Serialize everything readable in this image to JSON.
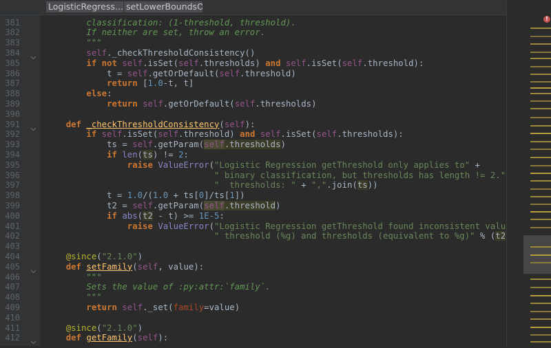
{
  "breadcrumbs": [
    "LogisticRegress…",
    "setLowerBoundsO…"
  ],
  "error_marker": "!",
  "colors": {
    "keyword": "#cc7832",
    "self": "#94558d",
    "string": "#6a8759",
    "docstring": "#629755",
    "number": "#6897bb",
    "function": "#ffc66d",
    "builtin": "#8888c6",
    "decorator": "#bbb529",
    "background": "#2b2b2b"
  },
  "first_line": "classification: (1-threshold, threshold).",
  "lines": [
    {
      "n": "381",
      "t": [
        [
          "doc",
          "        classification: (1-threshold, threshold).\n"
        ]
      ]
    },
    {
      "n": "382",
      "t": [
        [
          "doc",
          "        If neither are set, throw an error."
        ]
      ]
    },
    {
      "n": "383",
      "t": [
        [
          "doc",
          "        \"\"\""
        ]
      ]
    },
    {
      "n": "384",
      "t": [
        [
          "",
          "        "
        ],
        [
          "self",
          "self"
        ],
        [
          "",
          "._checkThresholdConsistency()"
        ]
      ]
    },
    {
      "n": "385",
      "t": [
        [
          "",
          "        "
        ],
        [
          "kw",
          "if not "
        ],
        [
          "self",
          "self"
        ],
        [
          "",
          ".isSet("
        ],
        [
          "self",
          "self"
        ],
        [
          "",
          ".thresholds) "
        ],
        [
          "kw",
          "and "
        ],
        [
          "self",
          "self"
        ],
        [
          "",
          ".isSet("
        ],
        [
          "self",
          "self"
        ],
        [
          "",
          ".threshold):"
        ]
      ]
    },
    {
      "n": "386",
      "t": [
        [
          "",
          "            t = "
        ],
        [
          "self",
          "self"
        ],
        [
          "",
          ".getOrDefault("
        ],
        [
          "self",
          "self"
        ],
        [
          "",
          ".threshold)"
        ]
      ]
    },
    {
      "n": "387",
      "t": [
        [
          "",
          "            "
        ],
        [
          "kw",
          "return "
        ],
        [
          "",
          "["
        ],
        [
          "num",
          "1.0"
        ],
        [
          "",
          "-t, t]"
        ]
      ]
    },
    {
      "n": "388",
      "t": [
        [
          "",
          "        "
        ],
        [
          "kw",
          "else"
        ],
        [
          "",
          ":"
        ]
      ]
    },
    {
      "n": "389",
      "t": [
        [
          "",
          "            "
        ],
        [
          "kw",
          "return "
        ],
        [
          "self",
          "self"
        ],
        [
          "",
          ".getOrDefault("
        ],
        [
          "self",
          "self"
        ],
        [
          "",
          ".thresholds)"
        ]
      ]
    },
    {
      "n": "390",
      "t": [
        [
          "",
          ""
        ]
      ]
    },
    {
      "n": "391",
      "t": [
        [
          "",
          "    "
        ],
        [
          "kw",
          "def "
        ],
        [
          "fnu",
          "_checkThresholdConsistency"
        ],
        [
          "",
          "("
        ],
        [
          "self",
          "self"
        ],
        [
          "",
          "):"
        ]
      ]
    },
    {
      "n": "392",
      "t": [
        [
          "",
          "        "
        ],
        [
          "kw",
          "if "
        ],
        [
          "self",
          "self"
        ],
        [
          "",
          ".isSet("
        ],
        [
          "self",
          "self"
        ],
        [
          "",
          ".threshold) "
        ],
        [
          "kw",
          "and "
        ],
        [
          "self",
          "self"
        ],
        [
          "",
          ".isSet("
        ],
        [
          "self",
          "self"
        ],
        [
          "",
          ".thresholds):"
        ]
      ]
    },
    {
      "n": "393",
      "t": [
        [
          "",
          "            ts = "
        ],
        [
          "self",
          "self"
        ],
        [
          "",
          ".getParam("
        ],
        [
          "hlself",
          "self"
        ],
        [
          "hl",
          ".thresholds"
        ],
        [
          "",
          ")"
        ]
      ]
    },
    {
      "n": "394",
      "t": [
        [
          "",
          "            "
        ],
        [
          "kw",
          "if "
        ],
        [
          "bi",
          "len"
        ],
        [
          "",
          "("
        ],
        [
          "hl",
          "ts"
        ],
        [
          "",
          ") != "
        ],
        [
          "num",
          "2"
        ],
        [
          "",
          ":"
        ]
      ]
    },
    {
      "n": "395",
      "t": [
        [
          "",
          "                "
        ],
        [
          "kw",
          "raise "
        ],
        [
          "bi",
          "ValueError"
        ],
        [
          "",
          "("
        ],
        [
          "str",
          "\"Logistic Regression getThreshold only applies to\""
        ],
        [
          "",
          " +"
        ]
      ]
    },
    {
      "n": "396",
      "t": [
        [
          "",
          "                                 "
        ],
        [
          "str",
          "\" binary classification, but thresholds has length != 2.\""
        ],
        [
          "",
          " +"
        ]
      ]
    },
    {
      "n": "397",
      "t": [
        [
          "",
          "                                 "
        ],
        [
          "str",
          "\"  thresholds: \""
        ],
        [
          "",
          " + "
        ],
        [
          "str",
          "\",\""
        ],
        [
          "",
          ".join("
        ],
        [
          "hl",
          "ts"
        ],
        [
          "",
          "))"
        ]
      ]
    },
    {
      "n": "398",
      "t": [
        [
          "",
          "            t = "
        ],
        [
          "num",
          "1.0"
        ],
        [
          "",
          "/("
        ],
        [
          "num",
          "1.0"
        ],
        [
          "",
          " + ts["
        ],
        [
          "num",
          "0"
        ],
        [
          "",
          "]/ts["
        ],
        [
          "num",
          "1"
        ],
        [
          "",
          "])"
        ]
      ]
    },
    {
      "n": "399",
      "t": [
        [
          "",
          "            t2 = "
        ],
        [
          "self",
          "self"
        ],
        [
          "",
          ".getParam("
        ],
        [
          "hlself",
          "self"
        ],
        [
          "hl",
          ".threshold"
        ],
        [
          "",
          ")"
        ]
      ]
    },
    {
      "n": "400",
      "t": [
        [
          "",
          "            "
        ],
        [
          "kw",
          "if "
        ],
        [
          "bi",
          "abs"
        ],
        [
          "",
          "("
        ],
        [
          "hl",
          "t2"
        ],
        [
          "",
          " - t) >= "
        ],
        [
          "num",
          "1E-5"
        ],
        [
          "",
          ":"
        ]
      ]
    },
    {
      "n": "401",
      "t": [
        [
          "",
          "                "
        ],
        [
          "kw",
          "raise "
        ],
        [
          "bi",
          "ValueError"
        ],
        [
          "",
          "("
        ],
        [
          "str",
          "\"Logistic Regression getThreshold found inconsistent values for\""
        ],
        [
          "",
          " +"
        ]
      ]
    },
    {
      "n": "402",
      "t": [
        [
          "",
          "                                 "
        ],
        [
          "str",
          "\" threshold (%g) and thresholds (equivalent to %g)\""
        ],
        [
          "",
          " % ("
        ],
        [
          "hl",
          "t2"
        ],
        [
          "",
          ", t))"
        ]
      ]
    },
    {
      "n": "403",
      "t": [
        [
          "",
          ""
        ]
      ]
    },
    {
      "n": "404",
      "t": [
        [
          "",
          "    "
        ],
        [
          "dec",
          "@since"
        ],
        [
          "",
          "("
        ],
        [
          "str",
          "\"2.1.0\""
        ],
        [
          "",
          ")"
        ]
      ]
    },
    {
      "n": "405",
      "t": [
        [
          "",
          "    "
        ],
        [
          "kw",
          "def "
        ],
        [
          "fnu",
          "setFamily"
        ],
        [
          "",
          "("
        ],
        [
          "self",
          "self"
        ],
        [
          "",
          ", value):"
        ]
      ]
    },
    {
      "n": "406",
      "t": [
        [
          "doc",
          "        \"\"\""
        ]
      ]
    },
    {
      "n": "407",
      "t": [
        [
          "doc",
          "        Sets the value of :py:attr:`family`."
        ]
      ]
    },
    {
      "n": "408",
      "t": [
        [
          "doc",
          "        \"\"\""
        ]
      ]
    },
    {
      "n": "409",
      "t": [
        [
          "",
          "        "
        ],
        [
          "kw",
          "return "
        ],
        [
          "self",
          "self"
        ],
        [
          "",
          "._set("
        ],
        [
          "kwa",
          "family"
        ],
        [
          "",
          "=value)"
        ]
      ]
    },
    {
      "n": "410",
      "t": [
        [
          "",
          ""
        ]
      ]
    },
    {
      "n": "411",
      "t": [
        [
          "",
          "    "
        ],
        [
          "dec",
          "@since"
        ],
        [
          "",
          "("
        ],
        [
          "str",
          "\"2.1.0\""
        ],
        [
          "",
          ")"
        ]
      ]
    },
    {
      "n": "412",
      "t": [
        [
          "",
          "    "
        ],
        [
          "kw",
          "def "
        ],
        [
          "fnu",
          "getFamily"
        ],
        [
          "",
          "("
        ],
        [
          "self",
          "self"
        ],
        [
          "",
          "):"
        ]
      ]
    }
  ]
}
